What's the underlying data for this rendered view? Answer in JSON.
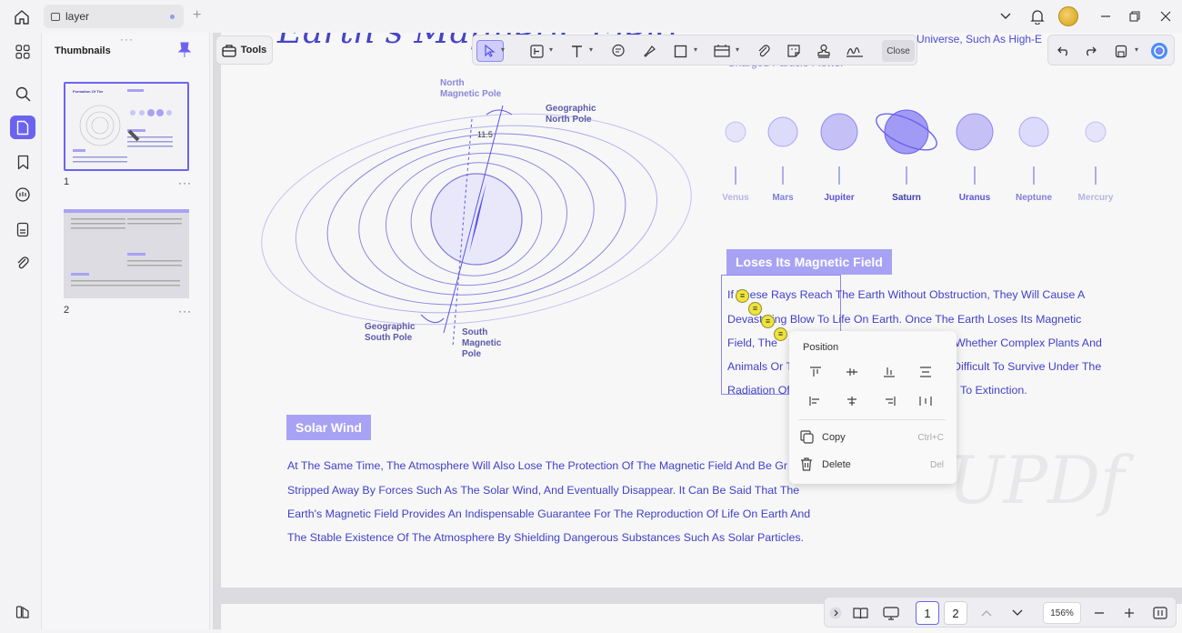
{
  "tab": {
    "label": "layer"
  },
  "thumbnails": {
    "title": "Thumbnails",
    "pages": [
      {
        "number": "1"
      },
      {
        "number": "2"
      }
    ],
    "more": "···",
    "handle": "···"
  },
  "toolbar": {
    "tools_label": "Tools",
    "close_label": "Close"
  },
  "document": {
    "title_fragment": "Earth's Magnetic Field",
    "top_right_line1": "Universe, Such As High-E",
    "top_right_line2": "Charged Particle Flows.",
    "diagram": {
      "north_magnetic_pole": [
        "North",
        "Magnetic Pole"
      ],
      "geographic_north_pole": [
        "Geographic",
        "North Pole"
      ],
      "geographic_south_pole": [
        "Geographic",
        "South Pole"
      ],
      "south_magnetic_pole": [
        "South",
        "Magnetic",
        "Pole"
      ],
      "angle": "11.5"
    },
    "planets": [
      "Venus",
      "Mars",
      "Jupiter",
      "Saturn",
      "Uranus",
      "Neptune",
      "Mercury"
    ],
    "section1_heading": "Loses Its Magnetic Field",
    "section1_lines": [
      "If These Rays Reach The Earth Without Obstruction, They Will Cause A",
      "Devastating Blow To Life On Earth. Once The Earth Loses Its Magnetic",
      "Field, The",
      "Whether Complex Plants And",
      "Animals Or T",
      "Difficult To Survive Under The",
      "Radiation Of",
      "To Extinction."
    ],
    "section2_heading": "Solar Wind",
    "section2_lines": [
      "At The Same Time, The Atmosphere Will Also Lose The Protection Of The Magnetic Field And Be Gr",
      "Stripped Away By Forces Such As The Solar Wind, And Eventually Disappear. It Can Be Said That The",
      "Earth's Magnetic Field Provides An Indispensable Guarantee For The Reproduction Of Life On Earth And",
      "The Stable Existence Of The Atmosphere By Shielding Dangerous Substances Such As Solar Particles."
    ],
    "watermark": "UPDf"
  },
  "context_menu": {
    "title": "Position",
    "copy_label": "Copy",
    "copy_shortcut": "Ctrl+C",
    "delete_label": "Delete",
    "delete_shortcut": "Del"
  },
  "bottom_bar": {
    "pages": [
      "1",
      "2"
    ],
    "current_page": "1",
    "zoom": "156%"
  },
  "colors": {
    "accent": "#6b63f0",
    "text_blue": "#4141c8",
    "tag": "#a8a2f4"
  }
}
